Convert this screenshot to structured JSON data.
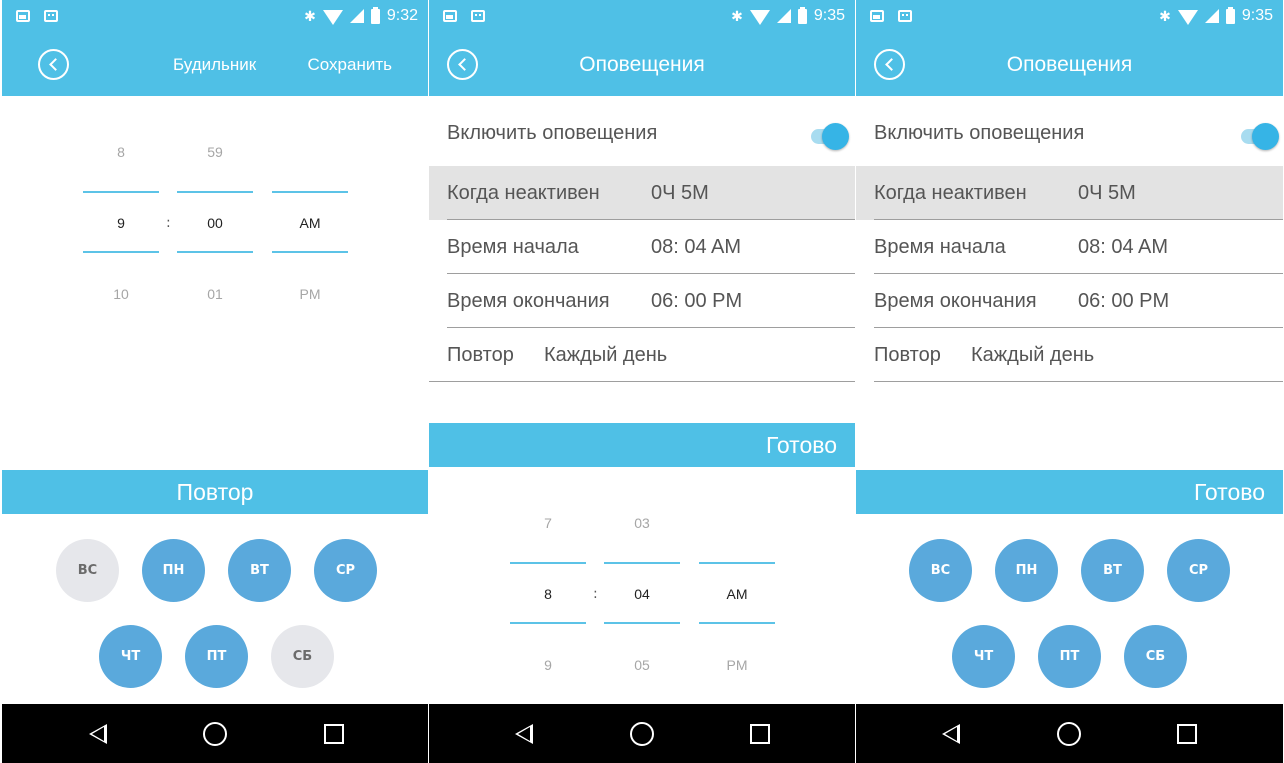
{
  "colors": {
    "accent": "#4fc0e6",
    "day_on": "#5aa9dc",
    "day_off": "#e6e7eb",
    "highlight_row": "#e3e3e3"
  },
  "panel1": {
    "status_time": "9:32",
    "title": "Будильник",
    "save_label": "Сохранить",
    "picker": {
      "hour": {
        "prev": "8",
        "current": "9",
        "next": "10"
      },
      "minute": {
        "prev": "59",
        "current": "00",
        "next": "01"
      },
      "ampm": {
        "prev": "",
        "current": "AM",
        "next": "PM"
      },
      "separator": ":"
    },
    "repeat_header": "Повтор",
    "days": [
      {
        "label": "ВС",
        "active": false
      },
      {
        "label": "ПН",
        "active": true
      },
      {
        "label": "ВТ",
        "active": true
      },
      {
        "label": "СР",
        "active": true
      },
      {
        "label": "ЧТ",
        "active": true
      },
      {
        "label": "ПТ",
        "active": true
      },
      {
        "label": "СБ",
        "active": false
      }
    ]
  },
  "panel2": {
    "status_time": "9:35",
    "title": "Оповещения",
    "enable_label": "Включить оповещения",
    "enable_on": true,
    "rows": [
      {
        "label": "Когда неактивен",
        "value": "0Ч 5М"
      },
      {
        "label": "Время начала",
        "value": "08: 04 AM"
      },
      {
        "label": "Время окончания",
        "value": "06: 00 PM"
      }
    ],
    "repeat": {
      "label": "Повтор",
      "value": "Каждый день"
    },
    "done_label": "Готово",
    "picker": {
      "hour": {
        "prev": "7",
        "current": "8",
        "next": "9"
      },
      "minute": {
        "prev": "03",
        "current": "04",
        "next": "05"
      },
      "ampm": {
        "prev": "",
        "current": "AM",
        "next": "PM"
      },
      "separator": ":"
    }
  },
  "panel3": {
    "status_time": "9:35",
    "title": "Оповещения",
    "enable_label": "Включить оповещения",
    "enable_on": true,
    "rows": [
      {
        "label": "Когда неактивен",
        "value": "0Ч 5М"
      },
      {
        "label": "Время начала",
        "value": "08: 04 AM"
      },
      {
        "label": "Время окончания",
        "value": "06: 00 PM"
      }
    ],
    "repeat": {
      "label": "Повтор",
      "value": "Каждый день"
    },
    "done_label": "Готово",
    "days": [
      {
        "label": "ВС",
        "active": true
      },
      {
        "label": "ПН",
        "active": true
      },
      {
        "label": "ВТ",
        "active": true
      },
      {
        "label": "СР",
        "active": true
      },
      {
        "label": "ЧТ",
        "active": true
      },
      {
        "label": "ПТ",
        "active": true
      },
      {
        "label": "СБ",
        "active": true
      }
    ]
  }
}
